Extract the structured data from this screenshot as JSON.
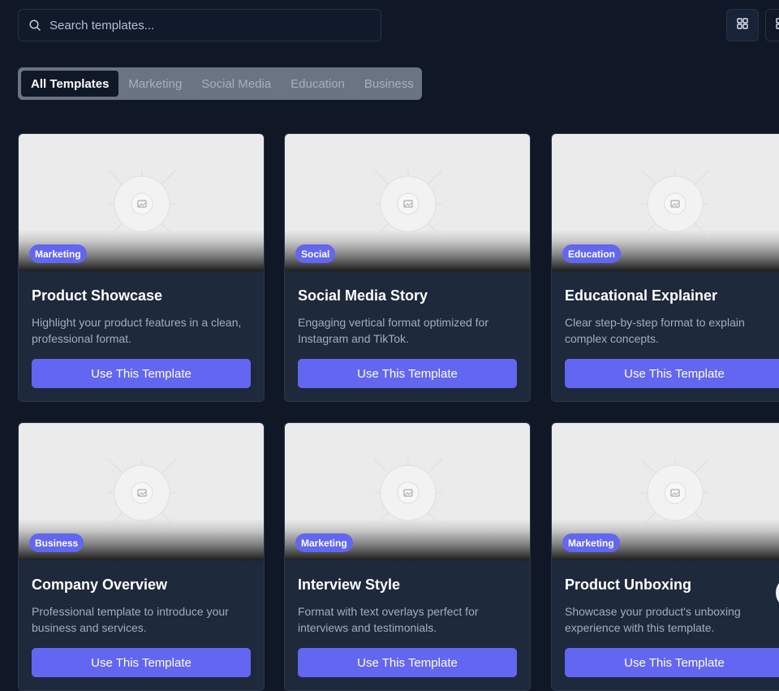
{
  "search": {
    "placeholder": "Search templates..."
  },
  "tabs": [
    {
      "label": "All Templates",
      "active": true
    },
    {
      "label": "Marketing",
      "active": false
    },
    {
      "label": "Social Media",
      "active": false
    },
    {
      "label": "Education",
      "active": false
    },
    {
      "label": "Business",
      "active": false
    }
  ],
  "view_controls": [
    {
      "icon": "grid-icon",
      "active": true
    },
    {
      "icon": "list-icon",
      "active": false
    }
  ],
  "templates": [
    {
      "badge": "Marketing",
      "title": "Product Showcase",
      "description": "Highlight your product features in a clean, professional format.",
      "button": "Use This Template"
    },
    {
      "badge": "Social",
      "title": "Social Media Story",
      "description": "Engaging vertical format optimized for Instagram and TikTok.",
      "button": "Use This Template"
    },
    {
      "badge": "Education",
      "title": "Educational Explainer",
      "description": "Clear step-by-step format to explain complex concepts.",
      "button": "Use This Template"
    },
    {
      "badge": "Business",
      "title": "Company Overview",
      "description": "Professional template to introduce your business and services.",
      "button": "Use This Template"
    },
    {
      "badge": "Marketing",
      "title": "Interview Style",
      "description": "Format with text overlays perfect for interviews and testimonials.",
      "button": "Use This Template"
    },
    {
      "badge": "Marketing",
      "title": "Product Unboxing",
      "description": "Showcase your product's unboxing experience with this template.",
      "button": "Use This Template"
    }
  ],
  "colors": {
    "background": "#101827",
    "card": "#1e293b",
    "accent": "#6366f1",
    "muted_text": "#a3adbb"
  }
}
